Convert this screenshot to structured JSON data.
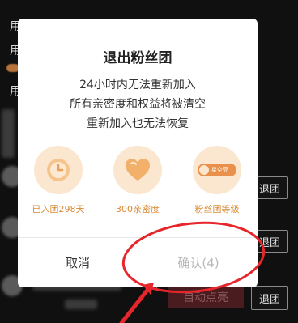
{
  "background": {
    "row_glyphs": [
      "用",
      "用",
      "用"
    ],
    "exit_button_label": "退团",
    "auto_light_label": "自动点亮"
  },
  "dialog": {
    "title": "退出粉丝团",
    "lines": [
      "24小时内无法重新加入",
      "所有亲密度和权益将被清空",
      "重新加入也无法恢复"
    ],
    "perks": [
      {
        "icon": "clock-icon",
        "label": "已入团298天"
      },
      {
        "icon": "heart-icon",
        "label": "300亲密度"
      },
      {
        "icon": "fan-badge-icon",
        "label": "粉丝团等级",
        "badge_text": "星空亮"
      }
    ],
    "cancel_label": "取消",
    "confirm_label": "确认(4)"
  },
  "annotation": {
    "color": "#e6262b"
  }
}
